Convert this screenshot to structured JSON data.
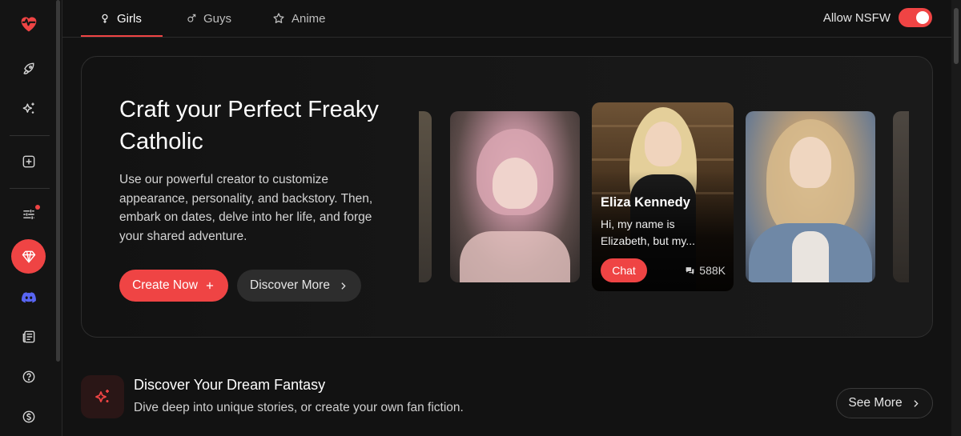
{
  "sidebar": {
    "items": [
      {
        "icon": "heart-pulse-icon"
      },
      {
        "icon": "rocket-icon"
      },
      {
        "icon": "sparkles-icon"
      },
      {
        "icon": "plus-square-icon"
      },
      {
        "icon": "sliders-icon"
      },
      {
        "icon": "diamond-icon"
      },
      {
        "icon": "discord-icon"
      },
      {
        "icon": "news-icon"
      },
      {
        "icon": "help-icon"
      },
      {
        "icon": "dollar-icon"
      }
    ]
  },
  "tabs": [
    {
      "label": "Girls",
      "icon": "female-icon",
      "active": true
    },
    {
      "label": "Guys",
      "icon": "male-icon",
      "active": false
    },
    {
      "label": "Anime",
      "icon": "star-icon",
      "active": false
    }
  ],
  "nsfw": {
    "label": "Allow NSFW",
    "enabled": true
  },
  "hero": {
    "title": "Craft your Perfect Freaky Catholic",
    "description": "Use our powerful creator to customize appearance, personality, and backstory. Then, embark on dates, delve into her life, and forge your shared adventure.",
    "create_label": "Create Now",
    "discover_label": "Discover More"
  },
  "featured_character": {
    "name": "Eliza Kennedy",
    "bio": "Hi, my name is Elizabeth, but my...",
    "chat_label": "Chat",
    "chat_count": "588K"
  },
  "section": {
    "title": "Discover Your Dream Fantasy",
    "subtitle": "Dive deep into unique stories, or create your own fan fiction.",
    "see_more_label": "See More"
  },
  "colors": {
    "accent": "#ef4444",
    "background": "#121212"
  }
}
